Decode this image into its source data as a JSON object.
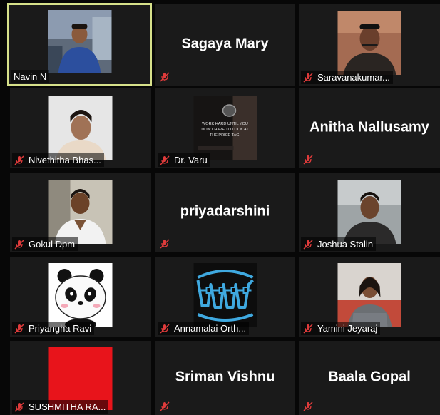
{
  "participants": [
    {
      "name": "Navin N",
      "muted": false,
      "active_speaker": true,
      "avatar": "photo-navin"
    },
    {
      "name": "Sagaya Mary",
      "muted": true,
      "display": "name-only"
    },
    {
      "name": "Saravanakumar...",
      "muted": true,
      "avatar": "photo-saravanakumar"
    },
    {
      "name": "Nivethitha Bhas...",
      "muted": true,
      "avatar": "photo-nivethitha"
    },
    {
      "name": "Dr. Varu",
      "muted": true,
      "avatar": "quote-watch-image",
      "avatar_text": [
        "WORK HARD UNTIL YOU",
        "DON'T HAVE TO LOOK AT",
        "THE PRICE TAG."
      ]
    },
    {
      "name": "Anitha Nallusamy",
      "muted": true,
      "display": "name-only"
    },
    {
      "name": "Gokul Dpm",
      "muted": true,
      "avatar": "photo-gokul"
    },
    {
      "name": "priyadarshini",
      "muted": true,
      "display": "name-only"
    },
    {
      "name": "Joshua Stalin",
      "muted": true,
      "avatar": "photo-joshua"
    },
    {
      "name": "Priyangha Ravi",
      "muted": true,
      "avatar": "panda-icon"
    },
    {
      "name": "Annamalai Orth...",
      "muted": true,
      "avatar": "teeth-braces-icon"
    },
    {
      "name": "Yamini Jeyaraj",
      "muted": true,
      "avatar": "photo-yamini"
    },
    {
      "name": "SUSHMITHA RA...",
      "muted": true,
      "avatar": "red-square"
    },
    {
      "name": "Sriman Vishnu",
      "muted": true,
      "display": "name-only"
    },
    {
      "name": "Baala Gopal",
      "muted": true,
      "display": "name-only"
    }
  ],
  "colors": {
    "background": "#070707",
    "tile": "#1a1a1a",
    "active_border": "#d6e08a",
    "muted_icon": "#e03b3b",
    "text": "#ffffff"
  }
}
